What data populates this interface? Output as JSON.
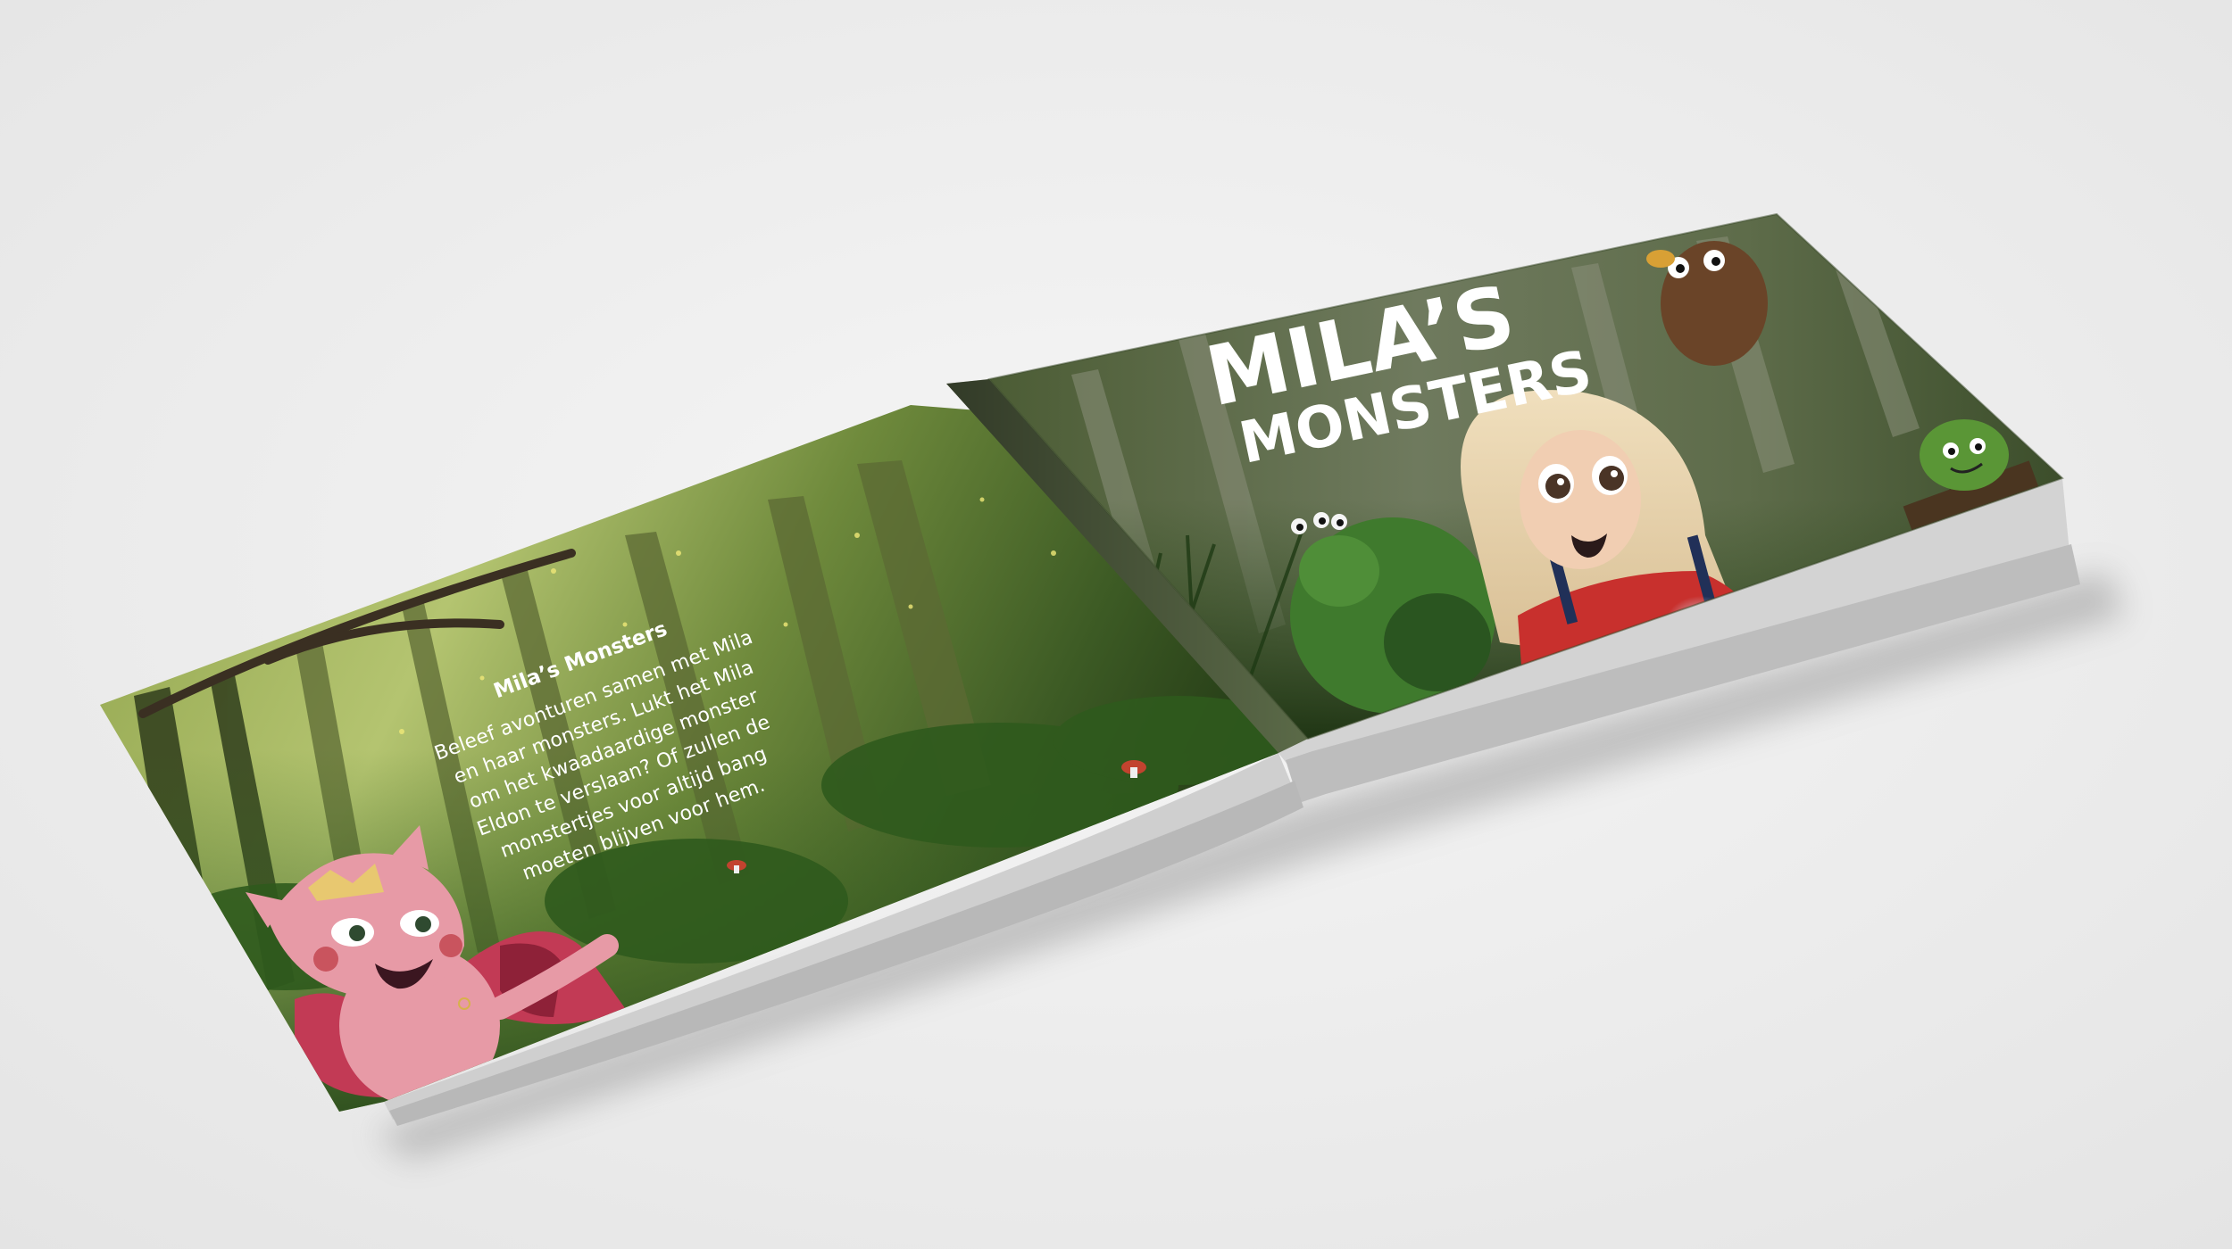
{
  "back_cover": {
    "title": "Mila’s Monsters",
    "blurb_lines": [
      "Beleef avonturen samen met Mila",
      "en haar monsters. Lukt het Mila",
      "om het kwaadaardige monster",
      "Eldon te verslaan? Of zullen de",
      "monstertjes voor altijd bang",
      "moeten blijven voor hem."
    ]
  },
  "front_cover": {
    "title_line1": "MILA’S",
    "title_line2": "MONSTERS"
  },
  "colors": {
    "background": "#eeeeee",
    "forest_dark": "#233417",
    "forest_light": "#a6b767",
    "sweater_red": "#c8302d",
    "pink_monster": "#e79aa6",
    "green_monster": "#3f7a2d"
  }
}
